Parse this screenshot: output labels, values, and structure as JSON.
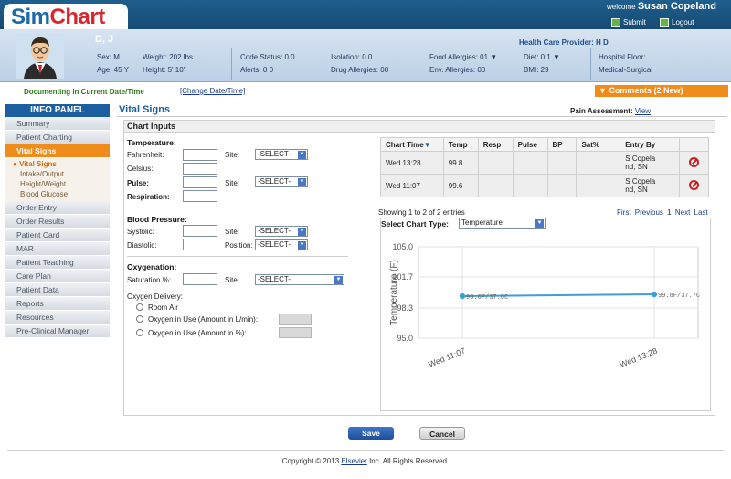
{
  "header": {
    "logo_sim": "Sim",
    "logo_chart": "Chart",
    "welcome_label": "welcome",
    "user_name": "Susan Copeland",
    "submit_label": "Submit",
    "logout_label": "Logout"
  },
  "patient": {
    "name": "D, J",
    "sex": "Sex: M",
    "age": "Age: 45 Y",
    "weight": "Weight: 202 lbs",
    "height": "Height: 5' 10\"",
    "code_status": "Code Status: 0 0",
    "alerts": "Alerts: 0 0",
    "isolation": "Isolation: 0 0",
    "drug_allergies": "Drug Allergies: 00",
    "food_allergies": "Food Allergies: 01",
    "env_allergies": "Env. Allergies: 00",
    "diet": "Diet: 0 1",
    "bmi": "BMI: 29",
    "provider": "Health Care Provider: H D",
    "hospital_floor_label": "Hospital Floor:",
    "hospital_floor": "Medical-Surgical"
  },
  "documenting": {
    "text": "Documenting in Current Date/Time",
    "change_link": "[Change Date/Time]"
  },
  "comments": {
    "label": "Comments (2 New)"
  },
  "info_panel": {
    "title": "INFO PANEL",
    "items_top": [
      "Summary",
      "Patient Charting"
    ],
    "active": "Vital Signs",
    "sub_head": "Vital Signs",
    "sub_items": [
      "Intake/Output",
      "Height/Weight",
      "Blood Glucose"
    ],
    "items_bottom": [
      "Order Entry",
      "Order Results",
      "Patient Card",
      "MAR",
      "Patient Teaching",
      "Care Plan",
      "Patient Data",
      "Reports",
      "Resources",
      "Pre-Clinical Manager"
    ]
  },
  "page": {
    "title": "Vital Signs",
    "pain_label": "Pain Assessment:",
    "pain_link": "View",
    "chart_inputs": "Chart Inputs"
  },
  "form": {
    "temperature": "Temperature:",
    "fahrenheit": "Fahrenheit:",
    "celsius": "Celsius:",
    "pulse": "Pulse:",
    "respiration": "Respiration:",
    "site": "Site:",
    "select": "-SELECT-",
    "blood_pressure": "Blood Pressure:",
    "systolic": "Systolic:",
    "diastolic": "Diastolic:",
    "position": "Position:",
    "oxygenation": "Oxygenation:",
    "saturation": "Saturation %:",
    "oxygen_delivery": "Oxygen Delivery:",
    "room_air": "Room Air",
    "o2_lmin": "Oxygen in Use (Amount in L/min):",
    "o2_pct": "Oxygen in Use (Amount in %):"
  },
  "table": {
    "headers": [
      "Chart Time",
      "Temp",
      "Resp",
      "Pulse",
      "BP",
      "Sat%",
      "Entry By",
      ""
    ],
    "rows": [
      {
        "time": "Wed 13:28",
        "temp": "99.8",
        "resp": "",
        "pulse": "",
        "bp": "",
        "sat": "",
        "entry1": "S Copela",
        "entry2": "nd, SN"
      },
      {
        "time": "Wed 11:07",
        "temp": "99.6",
        "resp": "",
        "pulse": "",
        "bp": "",
        "sat": "",
        "entry1": "S Copela",
        "entry2": "nd, SN"
      }
    ],
    "showing": "Showing 1 to 2 of 2 entries",
    "pager": {
      "first": "First",
      "previous": "Previous",
      "current": "1",
      "next": "Next",
      "last": "Last"
    }
  },
  "chart_select": {
    "label": "Select Chart Type:",
    "value": "Temperature"
  },
  "chart_data": {
    "type": "line",
    "ylabel": "Temperature (F)",
    "ylim": [
      95.0,
      105.0
    ],
    "yticks": [
      "95.0",
      "98.3",
      "101.7",
      "105.0"
    ],
    "categories": [
      "Wed 11:07",
      "Wed 13:28"
    ],
    "series": [
      {
        "values": [
          99.6,
          99.8
        ],
        "labels": [
          "99.6F/37.6C",
          "99.8F/37.7C"
        ]
      }
    ],
    "grid": true
  },
  "buttons": {
    "save": "Save",
    "cancel": "Cancel"
  },
  "footer": {
    "prefix": "Copyright © 2013",
    "link": "Elsevier",
    "suffix": "Inc. All Rights Reserved."
  }
}
